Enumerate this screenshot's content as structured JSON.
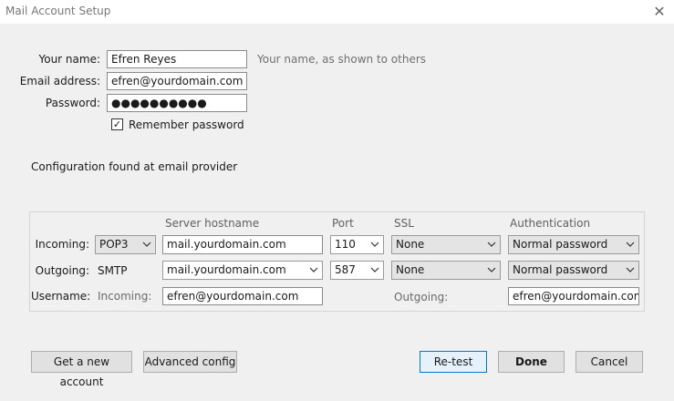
{
  "window": {
    "title": "Mail Account Setup",
    "close_glyph": "✕"
  },
  "form": {
    "name_label": "Your name:",
    "name_value": "Efren Reyes",
    "name_hint": "Your name, as shown to others",
    "email_label": "Email address:",
    "email_value": "efren@yourdomain.com",
    "password_label": "Password:",
    "password_value": "●●●●●●●●●●",
    "remember_label": "Remember password",
    "remember_checked": "✓"
  },
  "status": {
    "text": "Configuration found at email provider"
  },
  "server": {
    "headers": {
      "hostname": "Server hostname",
      "port": "Port",
      "ssl": "SSL",
      "auth": "Authentication"
    },
    "incoming": {
      "label": "Incoming:",
      "protocol": "POP3",
      "hostname": "mail.yourdomain.com",
      "port": "110",
      "ssl": "None",
      "auth": "Normal password"
    },
    "outgoing": {
      "label": "Outgoing:",
      "protocol": "SMTP",
      "hostname": "mail.yourdomain.com",
      "port": "587",
      "ssl": "None",
      "auth": "Normal password"
    },
    "username": {
      "label": "Username:",
      "incoming_label": "Incoming:",
      "incoming_value": "efren@yourdomain.com",
      "outgoing_label": "Outgoing:",
      "outgoing_value": "efren@yourdomain.com"
    }
  },
  "buttons": {
    "new_account": "Get a new account",
    "advanced": "Advanced config",
    "retest": "Re-test",
    "done": "Done",
    "cancel": "Cancel"
  },
  "colors": {
    "focus_border": "#0078d7",
    "focus_bg": "#e5f1fb"
  }
}
